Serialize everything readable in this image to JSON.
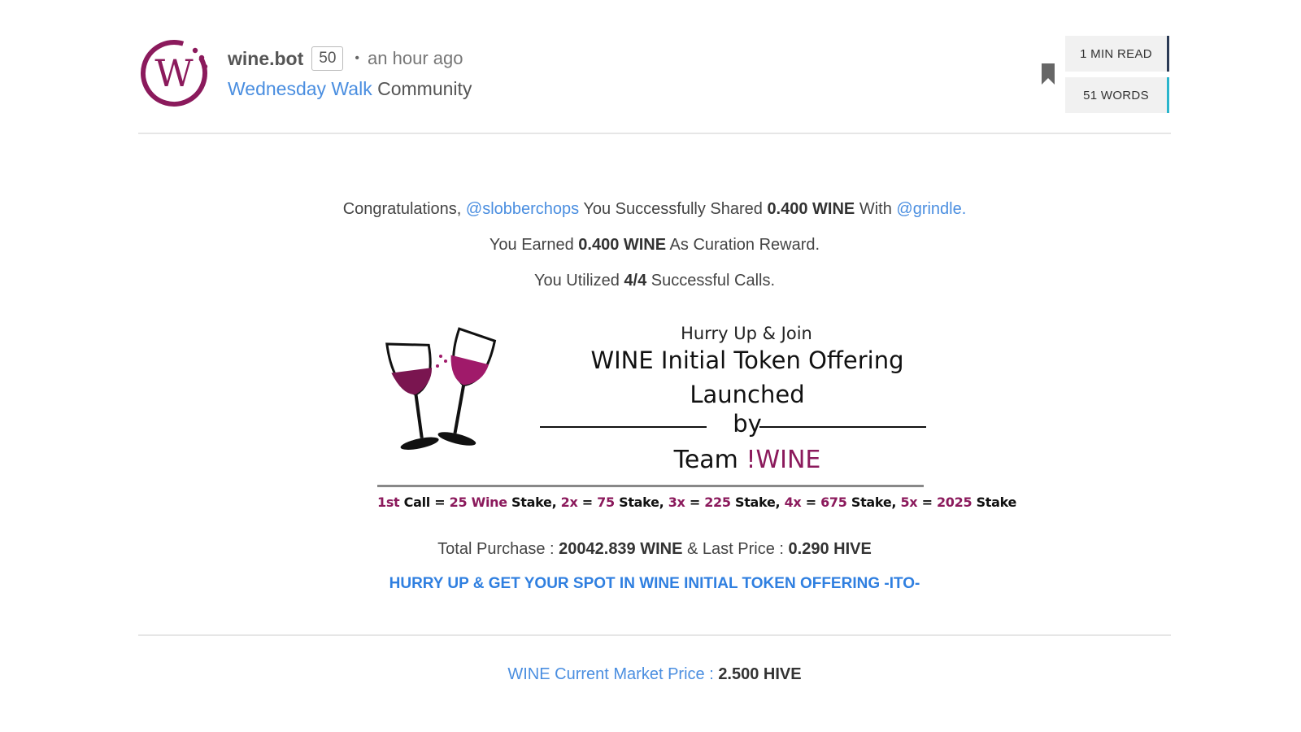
{
  "header": {
    "author": "wine.bot",
    "reputation": "50",
    "separator": "•",
    "time": "an hour ago",
    "community_link": "Wednesday Walk",
    "community_word": "Community",
    "read_time": "1 MIN READ",
    "word_count": "51 WORDS"
  },
  "body": {
    "line1": {
      "prefix": "Congratulations, ",
      "user": "@slobberchops",
      "mid": " You Successfully Shared ",
      "amount": "0.400 WINE",
      "with": " With ",
      "recipient": "@grindle",
      "end": "."
    },
    "line2": {
      "prefix": "You Earned ",
      "amount": "0.400 WINE",
      "suffix": " As Curation Reward."
    },
    "line3": {
      "prefix": "You Utilized ",
      "calls": "4/4",
      "suffix": " Successful Calls."
    },
    "banner": {
      "hurry": "Hurry Up & Join",
      "headline": "WINE Initial Token Offering",
      "launched": "Launched",
      "by": "by",
      "team_prefix": "Team ",
      "team_name": "!WINE",
      "stake": [
        {
          "text": "1st",
          "mag": true
        },
        {
          "text": " Call = ",
          "mag": false
        },
        {
          "text": "25",
          "mag": true
        },
        {
          "text": " ",
          "mag": false
        },
        {
          "text": "Wine",
          "mag": true
        },
        {
          "text": " Stake, ",
          "mag": false
        },
        {
          "text": "2x",
          "mag": true
        },
        {
          "text": " = ",
          "mag": false
        },
        {
          "text": "75",
          "mag": true
        },
        {
          "text": " Stake, ",
          "mag": false
        },
        {
          "text": "3x",
          "mag": true
        },
        {
          "text": " = ",
          "mag": false
        },
        {
          "text": "225",
          "mag": true
        },
        {
          "text": " Stake, ",
          "mag": false
        },
        {
          "text": "4x",
          "mag": true
        },
        {
          "text": " = ",
          "mag": false
        },
        {
          "text": "675",
          "mag": true
        },
        {
          "text": " Stake, ",
          "mag": false
        },
        {
          "text": "5x",
          "mag": true
        },
        {
          "text": " = ",
          "mag": false
        },
        {
          "text": "2025",
          "mag": true
        },
        {
          "text": " Stake",
          "mag": false
        }
      ]
    },
    "line4": {
      "prefix": "Total Purchase : ",
      "purchase": "20042.839 WINE",
      "mid": " & Last Price : ",
      "price": "0.290 HIVE"
    },
    "cta": "HURRY UP & GET YOUR SPOT IN WINE INITIAL TOKEN OFFERING -ITO-",
    "market": {
      "link": "WINE Current Market Price",
      "sep": " : ",
      "value": "2.500 HIVE"
    }
  },
  "colors": {
    "brand_wine": "#8b1a5c",
    "link_blue": "#4a8ee0",
    "cta_blue": "#2f7fe0",
    "read_accent": "#2b3a55",
    "words_accent": "#2ab5cc"
  },
  "icons": {
    "bookmark": "bookmark-icon",
    "avatar": "wine-logo-icon",
    "glasses": "wine-glasses-icon"
  }
}
